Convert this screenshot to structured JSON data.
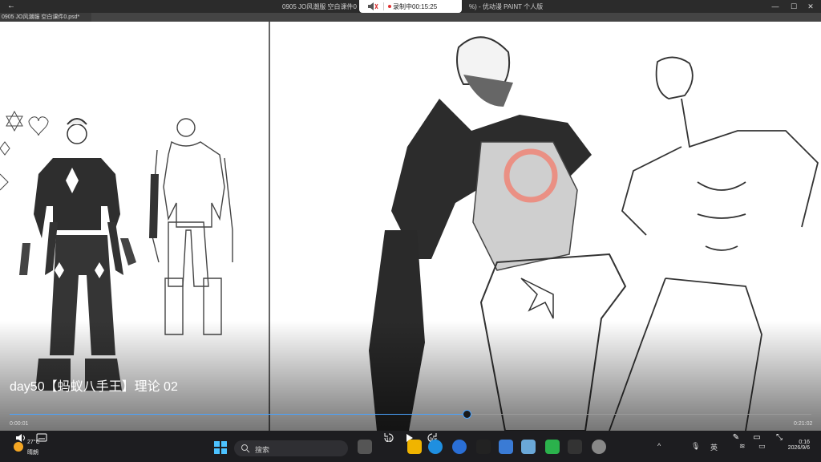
{
  "window": {
    "title_left": "0905 JO风潮服 空白课件0",
    "title_right": "%) - 优动漫 PAINT 个人版",
    "back_icon": "arrow-left-icon"
  },
  "recording": {
    "label": "录制中00:15:25",
    "dot_color": "#e03030"
  },
  "document": {
    "tab_label": "0905 JO风潮服 空白课件0.psd*"
  },
  "video": {
    "title": "day50【蚂蚁八手王】理论 02",
    "current_time": "0:00:01",
    "total_time": "0:21:02",
    "progress": 0.57,
    "accent_color": "#4aa3ff"
  },
  "player_controls": {
    "rewind_label": "10",
    "forward_label": "30"
  },
  "taskbar": {
    "weather_temp": "27°C",
    "weather_desc": "晴朗",
    "search_placeholder": "搜索",
    "ime_label": "英",
    "time": "0:16",
    "date": "2026/9/6"
  }
}
